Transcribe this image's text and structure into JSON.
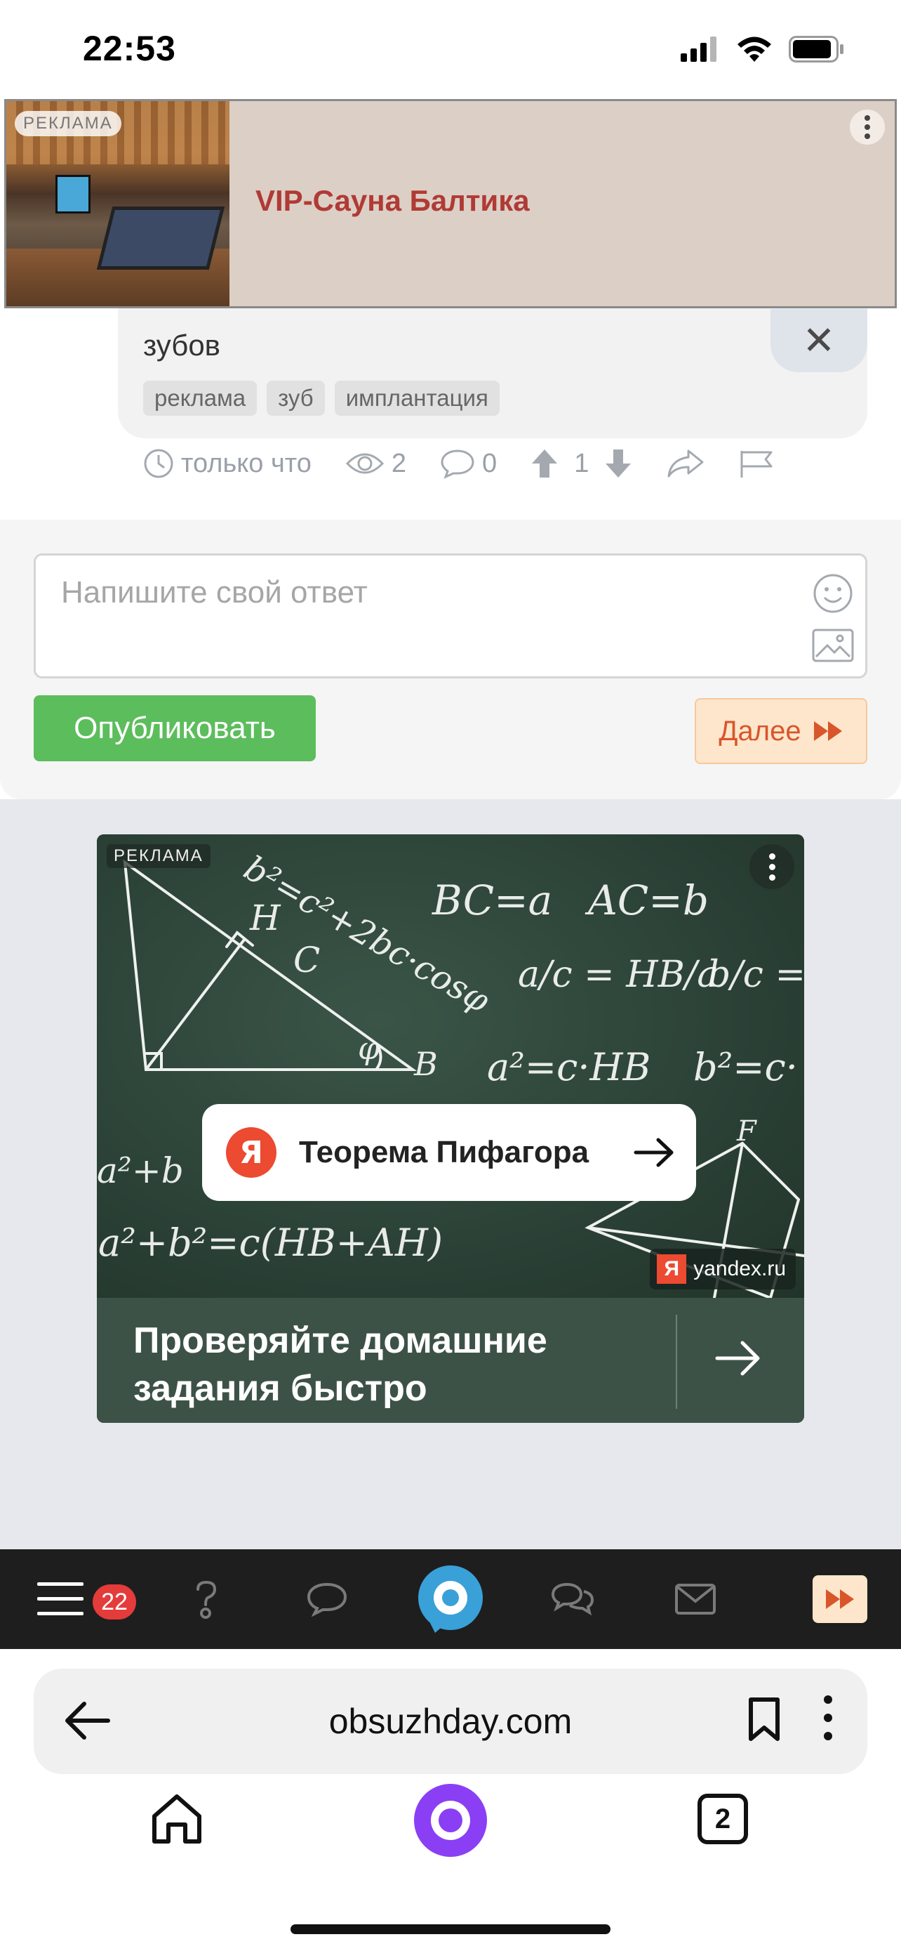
{
  "status_bar": {
    "time": "22:53"
  },
  "top_ad": {
    "tag": "РЕКЛАМА",
    "title": "VIP-Сауна Балтика"
  },
  "post": {
    "text_tail": "зубов",
    "tags": [
      "реклама",
      "зуб",
      "имплантация"
    ],
    "close_symbol": "✕",
    "meta": {
      "time": "только что",
      "views": "2",
      "comments": "0",
      "votes": "1"
    }
  },
  "reply": {
    "placeholder": "Напишите свой ответ",
    "publish_label": "Опубликовать",
    "next_label": "Далее"
  },
  "ad2": {
    "tag": "РЕКЛАМА",
    "search_logo": "Я",
    "search_text": "Теорема Пифагора",
    "source_logo": "Я",
    "source": "yandex.ru",
    "headline": "Проверяйте домашние задания быстро",
    "board_formulas": [
      "BC=a",
      "AC=b",
      "a/c = HB/a",
      "b/c =",
      "a²=c·HB",
      "b²=c·",
      "a²+b²=c(HB+AH)",
      "b²=c²+2bc·cosφ",
      "H",
      "C",
      "φ",
      "B",
      "a²+b",
      "F"
    ]
  },
  "app_nav": {
    "notifications_count": "22"
  },
  "browser": {
    "url": "obsuzhday.com",
    "tabs_count": "2"
  },
  "colors": {
    "publish": "#5cbd5c",
    "next": "#d8562a",
    "ad_title": "#b03a35",
    "badge": "#e43b3b",
    "nav_bg": "#1e1e1e",
    "alice": "#8a3ff5",
    "brand_ring": "#3aa0d8"
  }
}
